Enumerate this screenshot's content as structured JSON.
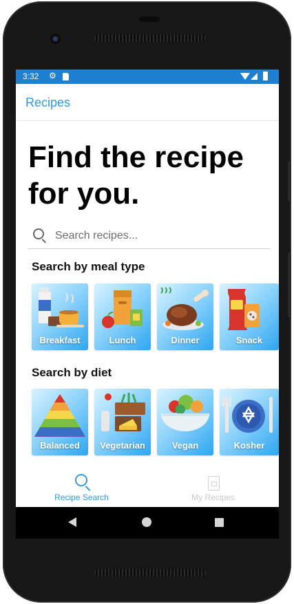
{
  "status_bar": {
    "time": "3:32"
  },
  "app_bar": {
    "title": "Recipes"
  },
  "headline": "Find the recipe for you.",
  "search": {
    "placeholder": "Search recipes..."
  },
  "meal_section": {
    "title": "Search by meal type",
    "items": [
      {
        "label": "Breakfast"
      },
      {
        "label": "Lunch"
      },
      {
        "label": "Dinner"
      },
      {
        "label": "Snack"
      }
    ]
  },
  "diet_section": {
    "title": "Search by diet",
    "items": [
      {
        "label": "Balanced"
      },
      {
        "label": "Vegetarian"
      },
      {
        "label": "Vegan"
      },
      {
        "label": "Kosher"
      }
    ]
  },
  "bottom_nav": {
    "items": [
      {
        "label": "Recipe Search",
        "active": true
      },
      {
        "label": "My Recipes",
        "active": false
      }
    ]
  },
  "colors": {
    "accent": "#2f9be0",
    "status_bar": "#1f7fd1"
  }
}
